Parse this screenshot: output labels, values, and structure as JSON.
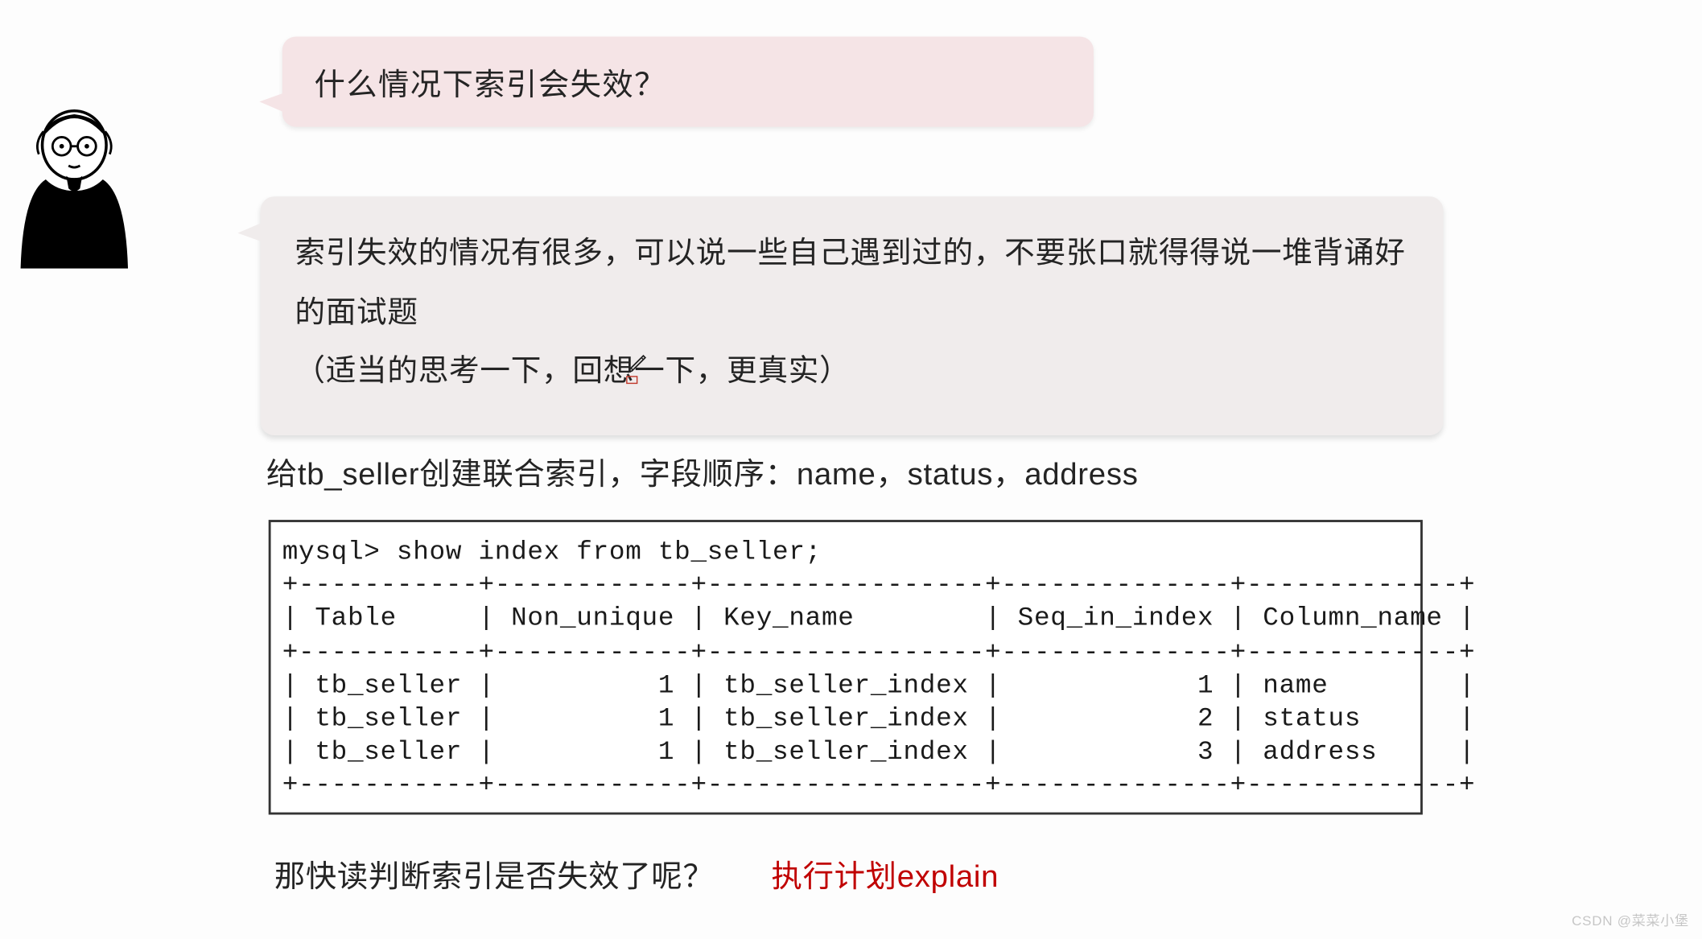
{
  "question": "什么情况下索引会失效？",
  "answer": "索引失效的情况有很多，可以说一些自己遇到过的，不要张口就得得说一堆背诵好的面试题\n（适当的思考一下，回想一下，更真实）",
  "instruction": "给tb_seller创建联合索引，字段顺序：name，status，address",
  "terminal": {
    "prompt": "mysql> show index from tb_seller;",
    "columns": [
      "Table",
      "Non_unique",
      "Key_name",
      "Seq_in_index",
      "Column_name"
    ],
    "rows": [
      {
        "Table": "tb_seller",
        "Non_unique": "1",
        "Key_name": "tb_seller_index",
        "Seq_in_index": "1",
        "Column_name": "name"
      },
      {
        "Table": "tb_seller",
        "Non_unique": "1",
        "Key_name": "tb_seller_index",
        "Seq_in_index": "2",
        "Column_name": "status"
      },
      {
        "Table": "tb_seller",
        "Non_unique": "1",
        "Key_name": "tb_seller_index",
        "Seq_in_index": "3",
        "Column_name": "address"
      }
    ],
    "rendered": "mysql> show index from tb_seller;\n+-----------+------------+-----------------+--------------+-------------+\n| Table     | Non_unique | Key_name        | Seq_in_index | Column_name |\n+-----------+------------+-----------------+--------------+-------------+\n| tb_seller |          1 | tb_seller_index |            1 | name        |\n| tb_seller |          1 | tb_seller_index |            2 | status      |\n| tb_seller |          1 | tb_seller_index |            3 | address     |\n+-----------+------------+-----------------+--------------+-------------+"
  },
  "bottom": {
    "black": "那快读判断索引是否失效了呢？",
    "red": "执行计划explain"
  },
  "watermark": "CSDN @菜菜小堡"
}
